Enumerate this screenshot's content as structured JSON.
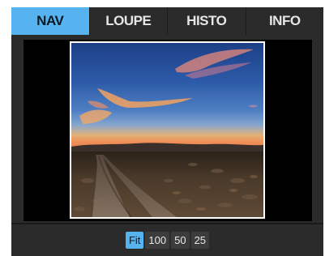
{
  "tabs": [
    {
      "label": "NAV",
      "active": true
    },
    {
      "label": "LOUPE",
      "active": false
    },
    {
      "label": "HISTO",
      "active": false
    },
    {
      "label": "INFO",
      "active": false
    }
  ],
  "zoom": {
    "options": [
      {
        "label": "Fit",
        "active": true
      },
      {
        "label": "100",
        "active": false
      },
      {
        "label": "50",
        "active": false
      },
      {
        "label": "25",
        "active": false
      }
    ]
  },
  "colors": {
    "accent": "#56b3f0",
    "panel_bg": "#2b2b2b",
    "viewer_bg": "#000000",
    "frame_border": "#ffffff"
  },
  "preview": {
    "icon": "landscape-photo-thumbnail"
  }
}
